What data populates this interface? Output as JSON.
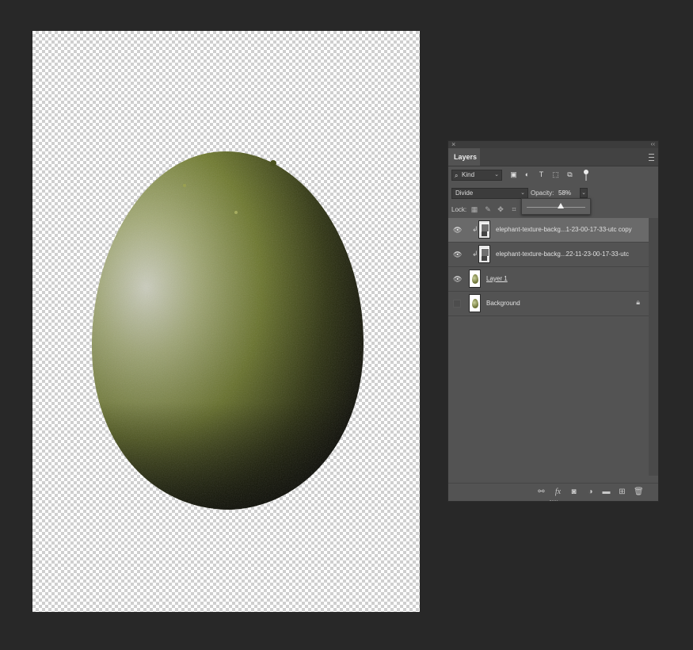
{
  "panel": {
    "close_glyph": "×",
    "collapse_glyph": "‹‹",
    "tab_label": "Layers",
    "menu_icon": "panel-menu-icon"
  },
  "filter": {
    "kind_label": "Kind",
    "icons": [
      "pixel-filter-icon",
      "adjustment-filter-icon",
      "type-filter-icon",
      "shape-filter-icon",
      "smart-object-filter-icon"
    ]
  },
  "blend": {
    "mode": "Divide",
    "opacity_label": "Opacity:",
    "opacity_value": "58%",
    "opacity_fraction": 0.58
  },
  "lock": {
    "label": "Lock:",
    "icons": [
      "lock-transparent-icon",
      "lock-image-icon",
      "lock-position-icon",
      "lock-artboard-icon"
    ]
  },
  "layers": [
    {
      "name": "elephant-texture-backg...1-23-00-17-33-utc copy",
      "visible": true,
      "clipped": true,
      "selected": true,
      "thumb": "texture"
    },
    {
      "name": "elephant-texture-backg...22-11-23-00-17-33-utc",
      "visible": true,
      "clipped": true,
      "selected": false,
      "thumb": "texture"
    },
    {
      "name": "Layer 1",
      "visible": true,
      "clipped": false,
      "selected": false,
      "thumb": "egg"
    },
    {
      "name": "Background",
      "visible": false,
      "clipped": false,
      "selected": false,
      "thumb": "egg",
      "locked": true
    }
  ],
  "bottom_icons": [
    "link-layers-icon",
    "fx-icon",
    "layer-mask-icon",
    "adjustment-layer-icon",
    "new-group-icon",
    "new-layer-icon",
    "trash-icon"
  ],
  "bottom_fx_label": "fx",
  "colors": {
    "app_bg": "#282828",
    "panel_bg": "#535353",
    "selected_layer": "#6a6a6a",
    "egg_light": "#c7cbb0",
    "egg_mid": "#6f7a2e",
    "egg_dark": "#101008"
  }
}
